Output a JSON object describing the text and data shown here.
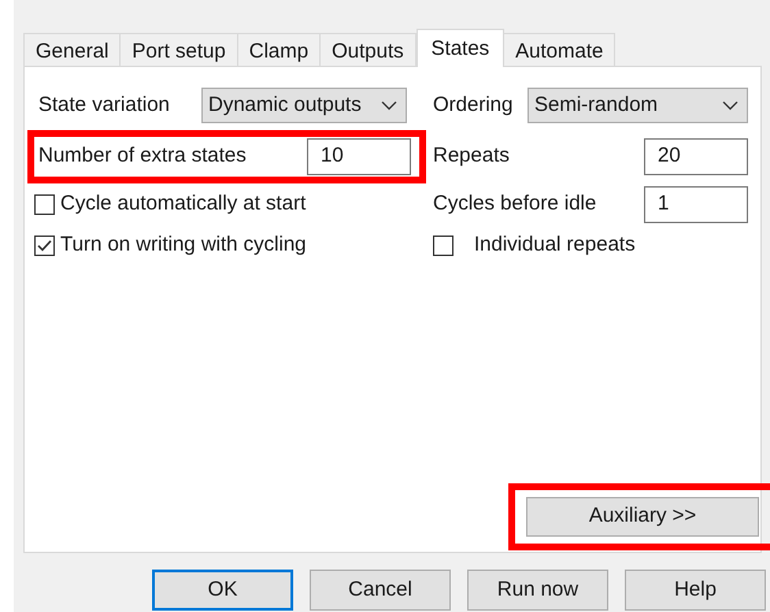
{
  "tabs": [
    {
      "label": "General",
      "selected": false
    },
    {
      "label": "Port setup",
      "selected": false
    },
    {
      "label": "Clamp",
      "selected": false
    },
    {
      "label": "Outputs",
      "selected": false
    },
    {
      "label": "States",
      "selected": true
    },
    {
      "label": "Automate",
      "selected": false
    }
  ],
  "left": [
    {
      "kind": "dropdown",
      "label": "State variation",
      "value": "Dynamic outputs",
      "highlighted": false
    },
    {
      "kind": "number",
      "label": "Number of extra states",
      "value": "10",
      "highlighted": true
    },
    {
      "kind": "checkbox",
      "label": "Cycle automatically at start",
      "checked": false,
      "highlighted": false
    },
    {
      "kind": "checkbox",
      "label": "Turn on writing with cycling",
      "checked": true,
      "highlighted": false
    }
  ],
  "right": [
    {
      "kind": "dropdown",
      "label": "Ordering",
      "value": "Semi-random",
      "highlighted": false
    },
    {
      "kind": "number",
      "label": "Repeats",
      "value": "20",
      "highlighted": false
    },
    {
      "kind": "number",
      "label": "Cycles before idle",
      "value": "1",
      "highlighted": false
    },
    {
      "kind": "checkbox",
      "label": "Individual repeats",
      "checked": false,
      "highlighted": false
    }
  ],
  "auxiliary_button": {
    "label": "Auxiliary >>",
    "highlighted": true
  },
  "buttons": [
    {
      "label": "OK",
      "default": true
    },
    {
      "label": "Cancel",
      "default": false
    },
    {
      "label": "Run now",
      "default": false
    },
    {
      "label": "Help",
      "default": false
    }
  ]
}
